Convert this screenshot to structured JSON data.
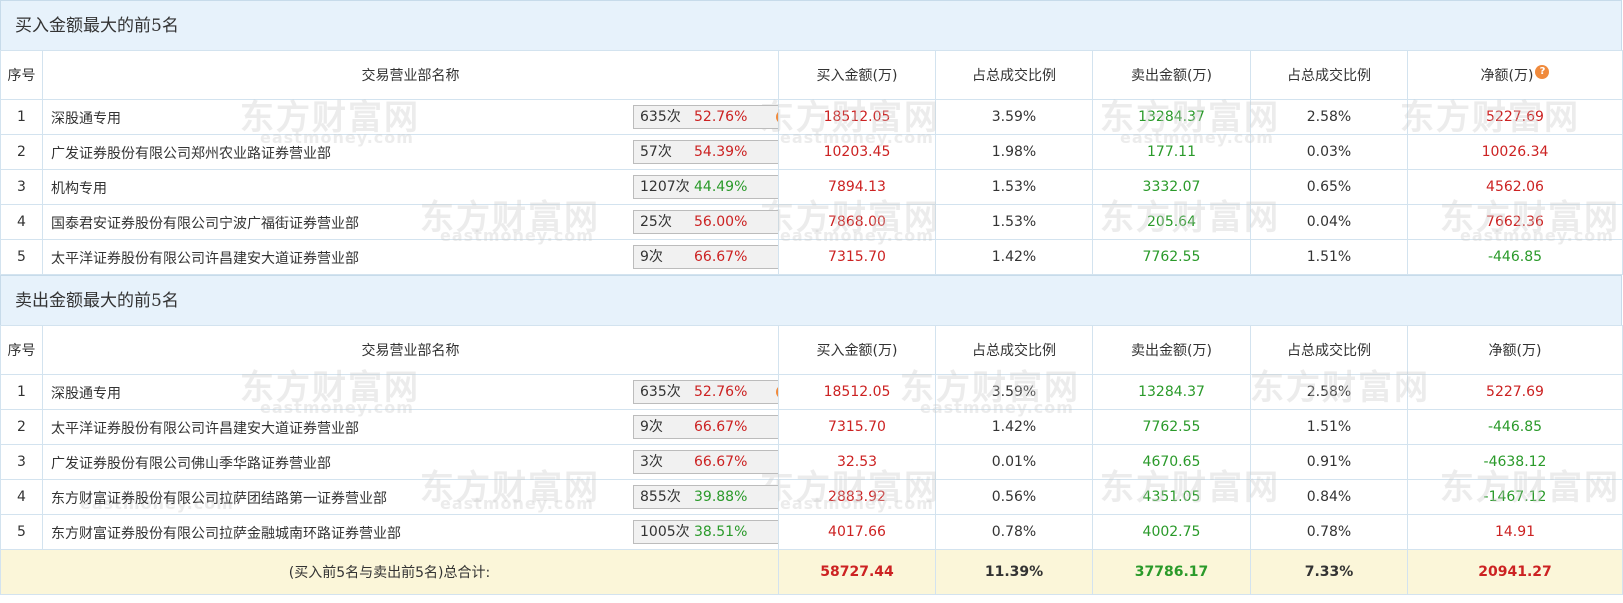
{
  "watermark": {
    "cn": "东方财富网",
    "en": "eastmoney.com"
  },
  "buy_section": {
    "title": "买入金额最大的前5名",
    "headers": {
      "rank": "序号",
      "dept": "交易营业部名称",
      "buy": "买入金额(万)",
      "buy_ratio": "占总成交比例",
      "sell": "卖出金额(万)",
      "sell_ratio": "占总成交比例",
      "net": "净额(万)"
    },
    "rows": [
      {
        "rank": "1",
        "name": "深股通专用",
        "count": "635次",
        "rate": "52.76%",
        "buy": "18512.05",
        "buy_ratio": "3.59%",
        "sell": "13284.37",
        "sell_ratio": "2.58%",
        "net": "5227.69"
      },
      {
        "rank": "2",
        "name": "广发证券股份有限公司郑州农业路证券营业部",
        "count": "57次",
        "rate": "54.39%",
        "buy": "10203.45",
        "buy_ratio": "1.98%",
        "sell": "177.11",
        "sell_ratio": "0.03%",
        "net": "10026.34"
      },
      {
        "rank": "3",
        "name": "机构专用",
        "count": "1207次",
        "rate": "44.49%",
        "buy": "7894.13",
        "buy_ratio": "1.53%",
        "sell": "3332.07",
        "sell_ratio": "0.65%",
        "net": "4562.06"
      },
      {
        "rank": "4",
        "name": "国泰君安证券股份有限公司宁波广福街证券营业部",
        "count": "25次",
        "rate": "56.00%",
        "buy": "7868.00",
        "buy_ratio": "1.53%",
        "sell": "205.64",
        "sell_ratio": "0.04%",
        "net": "7662.36"
      },
      {
        "rank": "5",
        "name": "太平洋证券股份有限公司许昌建安大道证券营业部",
        "count": "9次",
        "rate": "66.67%",
        "buy": "7315.70",
        "buy_ratio": "1.42%",
        "sell": "7762.55",
        "sell_ratio": "1.51%",
        "net": "-446.85"
      }
    ]
  },
  "sell_section": {
    "title": "卖出金额最大的前5名",
    "headers": {
      "rank": "序号",
      "dept": "交易营业部名称",
      "buy": "买入金额(万)",
      "buy_ratio": "占总成交比例",
      "sell": "卖出金额(万)",
      "sell_ratio": "占总成交比例",
      "net": "净额(万)"
    },
    "rows": [
      {
        "rank": "1",
        "name": "深股通专用",
        "count": "635次",
        "rate": "52.76%",
        "buy": "18512.05",
        "buy_ratio": "3.59%",
        "sell": "13284.37",
        "sell_ratio": "2.58%",
        "net": "5227.69"
      },
      {
        "rank": "2",
        "name": "太平洋证券股份有限公司许昌建安大道证券营业部",
        "count": "9次",
        "rate": "66.67%",
        "buy": "7315.70",
        "buy_ratio": "1.42%",
        "sell": "7762.55",
        "sell_ratio": "1.51%",
        "net": "-446.85"
      },
      {
        "rank": "3",
        "name": "广发证券股份有限公司佛山季华路证券营业部",
        "count": "3次",
        "rate": "66.67%",
        "buy": "32.53",
        "buy_ratio": "0.01%",
        "sell": "4670.65",
        "sell_ratio": "0.91%",
        "net": "-4638.12"
      },
      {
        "rank": "4",
        "name": "东方财富证券股份有限公司拉萨团结路第一证券营业部",
        "count": "855次",
        "rate": "39.88%",
        "buy": "2883.92",
        "buy_ratio": "0.56%",
        "sell": "4351.05",
        "sell_ratio": "0.84%",
        "net": "-1467.12"
      },
      {
        "rank": "5",
        "name": "东方财富证券股份有限公司拉萨金融城南环路证券营业部",
        "count": "1005次",
        "rate": "38.51%",
        "buy": "4017.66",
        "buy_ratio": "0.78%",
        "sell": "4002.75",
        "sell_ratio": "0.78%",
        "net": "14.91"
      }
    ]
  },
  "total": {
    "label": "(买入前5名与卖出前5名)总合计:",
    "buy": "58727.44",
    "buy_ratio": "11.39%",
    "sell": "37786.17",
    "sell_ratio": "7.33%",
    "net": "20941.27"
  },
  "colors": {
    "red": "#cc2222",
    "green": "#2a9a2a",
    "header_bg": "#e7f2fb",
    "total_bg": "#fbf6d9",
    "help_icon": "#f08a3c"
  },
  "icons": {
    "first_row": "question-icon",
    "other_rows": "arrow-right-icon",
    "net_header": "question-icon"
  }
}
